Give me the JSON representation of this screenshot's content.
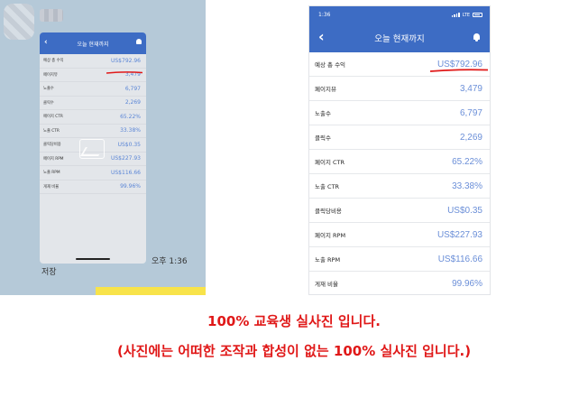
{
  "left_chat": {
    "time": "오후 1:36",
    "save_label": "저장",
    "thumbnail": {
      "title": "오늘 현재까지",
      "rows": [
        {
          "label": "예상 총 수익",
          "value": "US$792.96"
        },
        {
          "label": "페이지뷰",
          "value": "3,479"
        },
        {
          "label": "노출수",
          "value": "6,797"
        },
        {
          "label": "클릭수",
          "value": "2,269"
        },
        {
          "label": "페이지 CTR",
          "value": "65.22%"
        },
        {
          "label": "노출 CTR",
          "value": "33.38%"
        },
        {
          "label": "클릭당비용",
          "value": "US$0.35"
        },
        {
          "label": "페이지 RPM",
          "value": "US$227.93"
        },
        {
          "label": "노출 RPM",
          "value": "US$116.66"
        },
        {
          "label": "게재 비율",
          "value": "99.96%"
        }
      ]
    }
  },
  "phone": {
    "status": {
      "time": "1:36",
      "network": "LTE"
    },
    "title": "오늘 현재까지",
    "rows": [
      {
        "label": "예상 총 수익",
        "value": "US$792.96"
      },
      {
        "label": "페이지뷰",
        "value": "3,479"
      },
      {
        "label": "노출수",
        "value": "6,797"
      },
      {
        "label": "클릭수",
        "value": "2,269"
      },
      {
        "label": "페이지 CTR",
        "value": "65.22%"
      },
      {
        "label": "노출 CTR",
        "value": "33.38%"
      },
      {
        "label": "클릭당비용",
        "value": "US$0.35"
      },
      {
        "label": "페이지 RPM",
        "value": "US$227.93"
      },
      {
        "label": "노출 RPM",
        "value": "US$116.66"
      },
      {
        "label": "게재 비율",
        "value": "99.96%"
      }
    ]
  },
  "caption": {
    "line1": "100% 교육생 실사진 입니다.",
    "line2": "(사진에는 어떠한 조작과 합성이 없는 100% 실사진 입니다.)"
  },
  "colors": {
    "header_blue": "#3d6cc4",
    "value_blue": "#6b8fd8",
    "caption_red": "#e01818",
    "chat_bg": "#b5c9d8"
  }
}
